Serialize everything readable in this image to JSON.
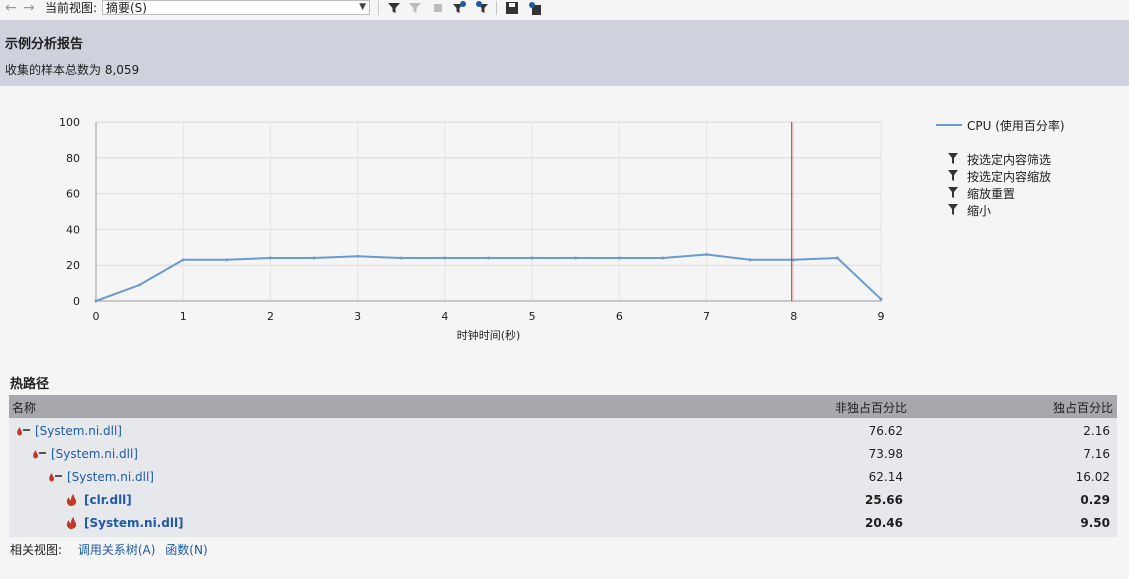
{
  "toolbar": {
    "back_icon": "←",
    "forward_icon": "→",
    "view_label": "当前视图:",
    "view_value": "摘要(S)"
  },
  "report": {
    "title": "示例分析报告",
    "samples": "收集的样本总数为 8,059"
  },
  "chart_data": {
    "type": "line",
    "xlabel": "时钟时间(秒)",
    "ylabel": "",
    "xlim": [
      0,
      9
    ],
    "ylim": [
      0,
      100
    ],
    "xticks": [
      "0",
      "1",
      "2",
      "3",
      "4",
      "5",
      "6",
      "7",
      "8",
      "9"
    ],
    "yticks": [
      "0",
      "20",
      "40",
      "60",
      "80",
      "100"
    ],
    "grid": true,
    "series": [
      {
        "name": "CPU (使用百分率)",
        "color": "#6a9bd0",
        "x": [
          0,
          0.5,
          1,
          1.5,
          2,
          2.5,
          3,
          3.5,
          4,
          4.5,
          5,
          5.5,
          6,
          6.5,
          7,
          7.5,
          8,
          8.5,
          9
        ],
        "y": [
          0,
          9,
          23,
          23,
          24,
          24,
          25,
          24,
          24,
          24,
          24,
          24,
          24,
          24,
          26,
          23,
          23,
          24,
          1
        ]
      }
    ],
    "marker_line_x": 8.0,
    "marker_color": "#b22222",
    "legend_position": "right"
  },
  "legend": {
    "series_label": "CPU (使用百分率)",
    "actions": [
      "按选定内容筛选",
      "按选定内容缩放",
      "缩放重置",
      "缩小"
    ]
  },
  "hot_path": {
    "title": "热路径",
    "columns": [
      "名称",
      "非独占百分比",
      "独占百分比"
    ],
    "rows": [
      {
        "name": "[System.ni.dll]",
        "inclusive": "76.62",
        "exclusive": "2.16"
      },
      {
        "name": "[System.ni.dll]",
        "inclusive": "73.98",
        "exclusive": "7.16"
      },
      {
        "name": "[System.ni.dll]",
        "inclusive": "62.14",
        "exclusive": "16.02"
      },
      {
        "name": "[clr.dll]",
        "inclusive": "25.66",
        "exclusive": "0.29"
      },
      {
        "name": "[System.ni.dll]",
        "inclusive": "20.46",
        "exclusive": "9.50"
      }
    ]
  },
  "related": {
    "label": "相关视图:",
    "links": [
      "调用关系树(A)",
      "函数(N)"
    ]
  }
}
